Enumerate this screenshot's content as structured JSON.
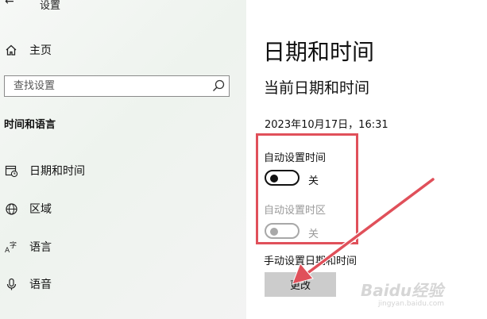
{
  "window": {
    "title": "设置"
  },
  "sidebar": {
    "home": {
      "label": "主页",
      "icon": "home-icon"
    },
    "search": {
      "placeholder": "查找设置",
      "value": "",
      "icon": "search-icon"
    },
    "section_heading": "时间和语言",
    "items": [
      {
        "label": "日期和时间",
        "icon": "calendar-clock-icon"
      },
      {
        "label": "区域",
        "icon": "globe-icon"
      },
      {
        "label": "语言",
        "icon": "language-icon"
      },
      {
        "label": "语音",
        "icon": "microphone-icon"
      }
    ]
  },
  "main": {
    "title": "日期和时间",
    "subtitle": "当前日期和时间",
    "current_datetime": "2023年10月17日，16:31",
    "auto_time": {
      "label": "自动设置时间",
      "state": "关",
      "on": false,
      "enabled": true
    },
    "auto_timezone": {
      "label": "自动设置时区",
      "state": "关",
      "on": false,
      "enabled": false
    },
    "manual": {
      "label": "手动设置日期和时间",
      "button_label": "更改"
    }
  },
  "annotation": {
    "box_color": "#e0505a",
    "arrow_color": "#e0505a"
  },
  "watermark": {
    "brand": "Baidu经验",
    "site": "jingyan.baidu.com"
  },
  "colors": {
    "text": "#111111",
    "disabled_text": "#9a9a9a",
    "button_bg": "#cccccc"
  }
}
